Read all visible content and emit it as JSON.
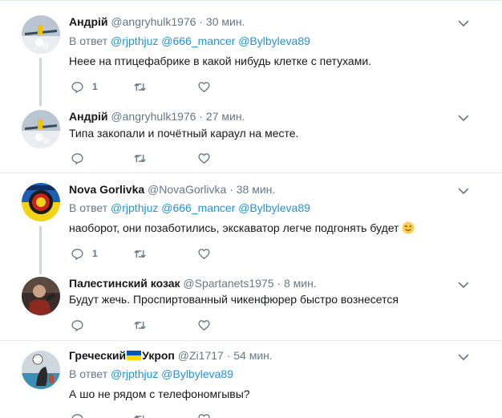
{
  "tweets": [
    {
      "name": "Андрій",
      "handle": "@angryhulk1976",
      "dot": "·",
      "time": "30 мин.",
      "reply_prefix": "В ответ",
      "mentions": [
        "@rjpthjuz",
        "@666_mancer",
        "@Bylbyleva89"
      ],
      "text": "Неее на птицефабрике в какой нибудь клетке с петухами.",
      "reply_count": "1"
    },
    {
      "name": "Андрій",
      "handle": "@angryhulk1976",
      "dot": "·",
      "time": "27 мин.",
      "text": "Типа закопали и почётный караул на месте."
    },
    {
      "name": "Nova Gorlivka",
      "handle": "@NovaGorlivka",
      "dot": "·",
      "time": "38 мин.",
      "reply_prefix": "В ответ",
      "mentions": [
        "@rjpthjuz",
        "@666_mancer",
        "@Bylbyleva89"
      ],
      "text": "наоборот, они позаботились, экскаватор легче подгонять будет",
      "reply_count": "1"
    },
    {
      "name": "Палестинский козак",
      "handle": "@Spartanets1975",
      "dot": "·",
      "time": "8 мин.",
      "text": "Будут жечь. Проспиртованный чикенфюрер быстро вознесется"
    },
    {
      "name_part1": "Греческий",
      "name_part2": "Укроп",
      "handle": "@Zi1717",
      "dot": "·",
      "time": "54 мин.",
      "reply_prefix": "В ответ",
      "mentions": [
        "@rjpthjuz",
        "@Bylbyleva89"
      ],
      "text": "А шо не рядом с телефономгывы?"
    }
  ],
  "icons": {
    "reply": "reply-icon",
    "retweet": "retweet-icon",
    "like": "heart-icon",
    "caret": "chevron-down-icon",
    "emoji": "winking-face-emoji",
    "flag": "ukraine-flag-emoji"
  },
  "colors": {
    "text": "#14171a",
    "secondary": "#657786",
    "link": "#1b95e0",
    "divider": "#e6ecf0",
    "thread_line": "#ccd6dd"
  }
}
